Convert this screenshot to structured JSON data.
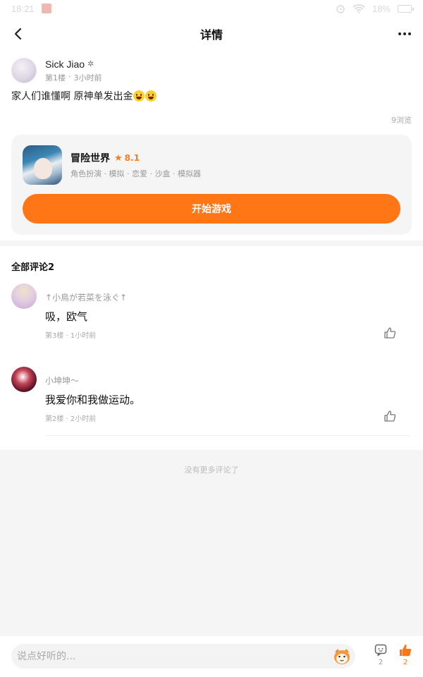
{
  "status_bar": {
    "time": "18:21",
    "battery": "18%"
  },
  "header": {
    "title": "详情"
  },
  "post": {
    "author_name": "Sick Jiao",
    "floor": "第1楼",
    "time": "3小时前",
    "text": "家人们谁懂啊  原神单发出金",
    "views": "9浏览"
  },
  "game": {
    "name": "冒险世界",
    "rating": "8.1",
    "tags": "角色扮演 · 模拟 · 恋爱 · 沙盒 · 模拟器",
    "start_label": "开始游戏"
  },
  "comments_section": {
    "title": "全部评论2",
    "items": [
      {
        "name": "↑小鳥が若菜を泳ぐ↑",
        "text": "吸，欧气",
        "meta": "第3楼 · 1小时前"
      },
      {
        "name": "小坤坤～",
        "text": "我爱你和我做运动。",
        "meta": "第2楼 · 2小时前"
      }
    ],
    "no_more": "没有更多评论了"
  },
  "bottom_bar": {
    "input_placeholder": "说点好听的...",
    "comment_count": "2",
    "like_count": "2"
  },
  "colors": {
    "accent": "#ff7616",
    "background": "#f5f5f5"
  }
}
